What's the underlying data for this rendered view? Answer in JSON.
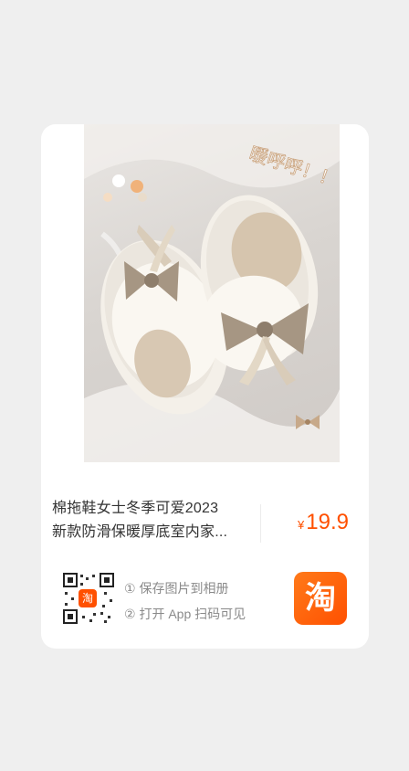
{
  "product": {
    "title_line1": "棉拖鞋女士冬季可爱2023",
    "title_line2": "新款防滑保暖厚底室内家...",
    "price_symbol": "¥",
    "price_value": "19.9",
    "image_caption": "暖呼呼！！"
  },
  "share": {
    "qr_badge_char": "淘",
    "step1": "① 保存图片到相册",
    "step2": "② 打开 App 扫码可见",
    "app_icon_char": "淘"
  },
  "colors": {
    "accent": "#ff5000",
    "background": "#efefef",
    "card": "#ffffff"
  }
}
